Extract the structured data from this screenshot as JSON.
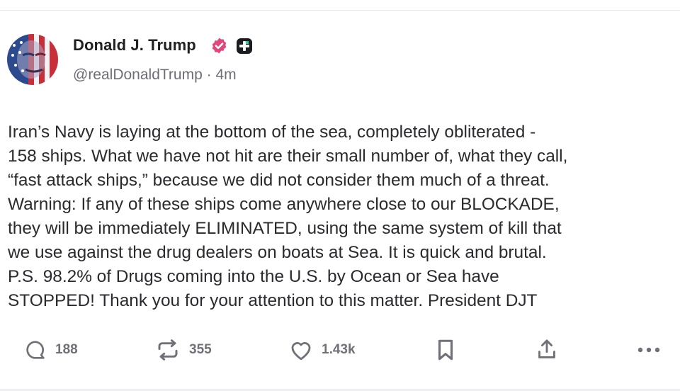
{
  "post": {
    "author": {
      "display_name": "Donald J. Trump",
      "handle": "@realDonaldTrump",
      "separator": "·",
      "time": "4m",
      "badge_icon": "verified-badge-icon",
      "badge_color": "#e0487a"
    },
    "body_lines": [
      "Iran’s Navy is laying at the bottom of the sea, completely obliterated -",
      "158 ships. What we have not hit are their small number of, what they call,",
      "“fast attack ships,” because we did not consider them much of a threat.",
      "Warning: If any of these ships come anywhere close to our BLOCKADE,",
      "they will be immediately ELIMINATED, using the same system of kill that",
      "we use against the drug dealers on boats at Sea. It is quick and brutal.",
      "P.S. 98.2% of Drugs coming into the U.S. by Ocean or Sea have",
      "STOPPED! Thank you for your attention to this matter. President DJT"
    ],
    "actions": {
      "reply": {
        "icon": "reply-icon",
        "count": "188"
      },
      "repost": {
        "icon": "repost-icon",
        "count": "355"
      },
      "like": {
        "icon": "heart-icon",
        "count": "1.43k"
      },
      "bookmark": {
        "icon": "bookmark-icon"
      },
      "share": {
        "icon": "share-icon"
      },
      "more": {
        "icon": "more-icon"
      }
    }
  },
  "colors": {
    "text": "#2a2a2f",
    "muted": "#6d6d78",
    "icon": "#707078",
    "verified": "#e0487a"
  }
}
